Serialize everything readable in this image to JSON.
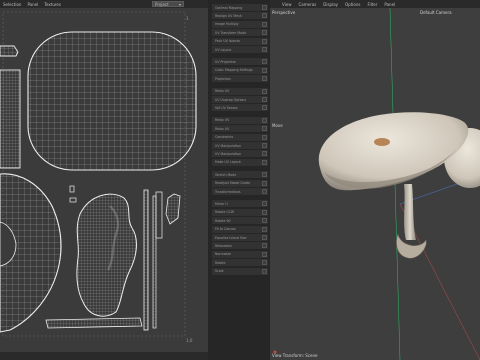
{
  "uv_editor": {
    "menu": [
      "Selection",
      "Panel",
      "Textures"
    ],
    "dropdown_value": "Project"
  },
  "tool_panel": {
    "rows": [
      "Optimal Mapping",
      "Realign UV Mesh",
      "Image Multiply",
      "UV Transform Mode",
      "Pack UV Islands",
      "UV Layout",
      "",
      "UV Projection",
      "Cubic Mapping Settings",
      "Projection",
      "",
      "Relax UV",
      "UV Unwrap Options",
      "Set UV Seams",
      "",
      "Relax UV",
      "Relax UV",
      "Constraints",
      "UV Manipulation",
      "UV Manipulation",
      "Make UV Layout",
      "",
      "Stretch Mode",
      "Readjust Model Grade",
      "Transformations",
      "",
      "Mirror U",
      "Rotate CCW",
      "Rotate 90",
      "Fit to Canvas",
      "Equalize Island Size",
      "Relaxation",
      "Normalize",
      "Rotate",
      "Scale"
    ]
  },
  "viewport": {
    "menu": [
      "View",
      "Cameras",
      "Display",
      "Options",
      "Filter",
      "Panel"
    ],
    "projection_label": "Perspective",
    "camera_label": "Default Camera",
    "side_label": "Move",
    "status_text": "View Transform: Scene"
  },
  "colors": {
    "uv_background": "#3b3b3b",
    "uv_wire": "#e8e8e8",
    "viewport_background": "#3e3e3e",
    "axis_green": "#2fbf6a",
    "axis_red": "#c04a4a",
    "axis_blue": "#4a7ad0",
    "cap_fill": "#d9d2c8"
  }
}
